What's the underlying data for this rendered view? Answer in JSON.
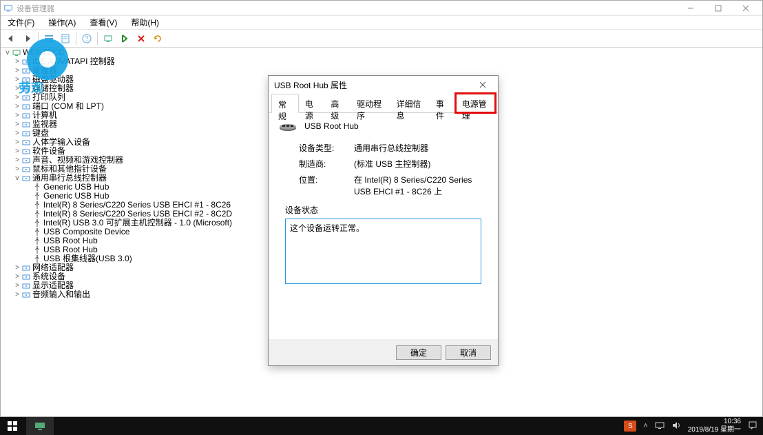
{
  "window": {
    "title": "设备管理器"
  },
  "menubar": {
    "file": "文件(F)",
    "action": "操作(A)",
    "view": "查看(V)",
    "help": "帮助(H)"
  },
  "tree": {
    "root": "WENTECC",
    "items": [
      "IDE ATA/ATAPI 控制器",
      "处理器",
      "磁盘驱动器",
      "存储控制器",
      "打印队列",
      "端口 (COM 和 LPT)",
      "计算机",
      "监视器",
      "键盘",
      "人体学输入设备",
      "软件设备",
      "声音、视频和游戏控制器",
      "鼠标和其他指针设备",
      "通用串行总线控制器",
      "网络适配器",
      "系统设备",
      "显示适配器",
      "音频输入和输出"
    ],
    "usb_children": [
      "Generic USB Hub",
      "Generic USB Hub",
      "Intel(R) 8 Series/C220 Series USB EHCI #1 - 8C26",
      "Intel(R) 8 Series/C220 Series USB EHCI #2 - 8C2D",
      "Intel(R) USB 3.0 可扩展主机控制器 - 1.0 (Microsoft)",
      "USB Composite Device",
      "USB Root Hub",
      "USB Root Hub",
      "USB 根集线器(USB 3.0)"
    ]
  },
  "watermark": {
    "text": "劳观"
  },
  "dialog": {
    "title": "USB Root Hub 属性",
    "tabs": {
      "general": "常规",
      "power": "电源",
      "advanced": "高级",
      "driver": "驱动程序",
      "details": "详细信息",
      "events": "事件",
      "power_mgmt": "电源管理"
    },
    "device_name": "USB Root Hub",
    "labels": {
      "type": "设备类型:",
      "mfr": "制造商:",
      "location": "位置:",
      "status": "设备状态"
    },
    "values": {
      "type": "通用串行总线控制器",
      "mfr": "(标准 USB 主控制器)",
      "location": "在 Intel(R) 8 Series/C220 Series USB EHCI #1 - 8C26 上"
    },
    "status_text": "这个设备运转正常。",
    "buttons": {
      "ok": "确定",
      "cancel": "取消"
    }
  },
  "taskbar": {
    "ime": "S",
    "time": "10:36",
    "date": "2019/8/19 星期一"
  }
}
